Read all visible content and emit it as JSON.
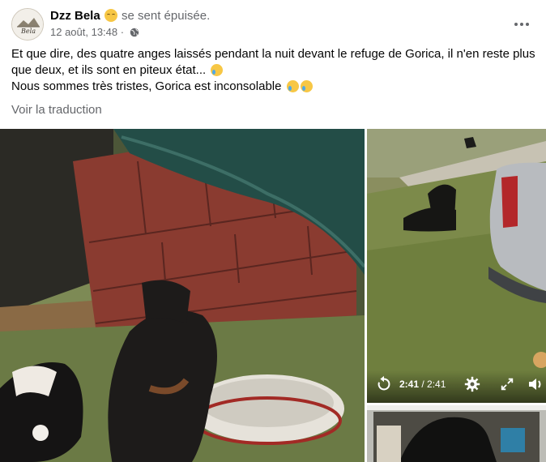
{
  "post": {
    "author": "Dzz Bela",
    "feeling": "se sent épuisée.",
    "feeling_icon": "tired-face-emoji",
    "date": "12 août, 13:48",
    "separator": "·",
    "privacy_icon": "globe-icon",
    "more_icon": "more-options-icon",
    "text_line_1": "Et que dire, des quatre anges laissés pendant la nuit devant le refuge de Gorica, il n'en reste plus que deux, et ils sont en piteux état...",
    "text_line_2": "Nous sommes très tristes, Gorica est inconsolable",
    "emoji": "crying-face-emoji",
    "translate_label": "Voir la traduction"
  },
  "avatar": {
    "logo_text": "Bela"
  },
  "video": {
    "current_time": "2:41",
    "separator": " / ",
    "duration": "2:41",
    "progress": 1.0,
    "icons": [
      "replay-icon",
      "settings-icon",
      "fullscreen-icon",
      "volume-icon"
    ]
  },
  "colors": {
    "secondary_text": "#65676b",
    "primary_text": "#050505",
    "background": "#ffffff"
  }
}
